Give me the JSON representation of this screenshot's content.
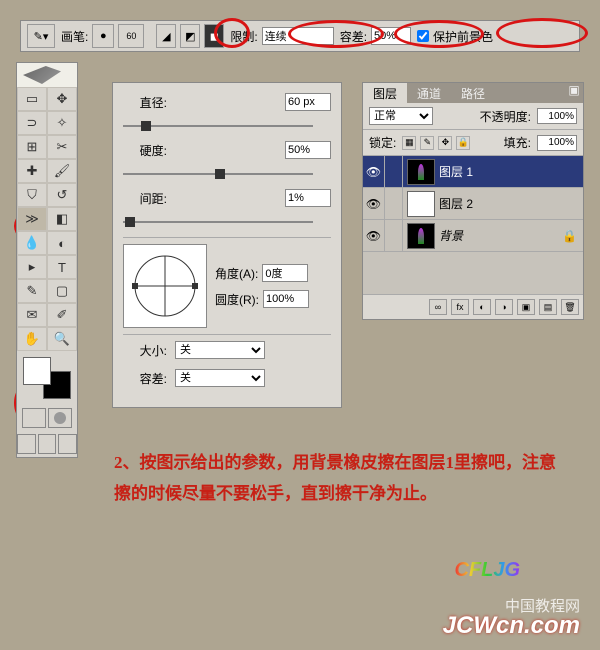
{
  "topbar": {
    "brush_label": "画笔:",
    "brush_size": "60",
    "limit_label": "限制:",
    "limit_value": "连续",
    "tolerance_label": "容差:",
    "tolerance_value": "50%",
    "protect_fg": "保护前景色"
  },
  "brush_panel": {
    "diameter_label": "直径:",
    "diameter_value": "60 px",
    "hardness_label": "硬度:",
    "hardness_value": "50%",
    "spacing_label": "间距:",
    "spacing_value": "1%",
    "angle_label": "角度(A):",
    "angle_value": "0度",
    "round_label": "圆度(R):",
    "round_value": "100%",
    "size_label": "大小:",
    "size_value": "关",
    "tol_label": "容差:",
    "tol_value": "关"
  },
  "layers": {
    "tab_layers": "图层",
    "tab_channels": "通道",
    "tab_paths": "路径",
    "blend_mode": "正常",
    "opacity_label": "不透明度:",
    "opacity_value": "100%",
    "lock_label": "锁定:",
    "fill_label": "填充:",
    "fill_value": "100%",
    "items": [
      {
        "name": "图层 1"
      },
      {
        "name": "图层 2"
      },
      {
        "name": "背景"
      }
    ]
  },
  "instruction": "2、按图示给出的参数，用背景橡皮擦在图层1里擦吧，注意擦的时候尽量不要松手，直到擦干净为止。",
  "logo": "CFLJG",
  "watermark1": "中国教程网",
  "watermark2": "JCWcn.com"
}
